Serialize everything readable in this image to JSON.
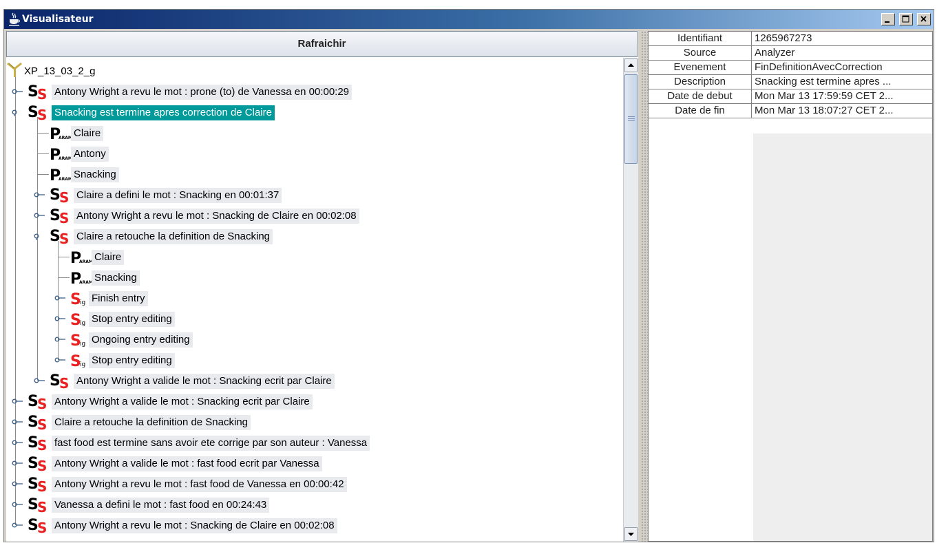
{
  "window": {
    "title": "Visualisateur",
    "controls": {
      "minimize": "minimize",
      "maximize": "maximize",
      "close": "close"
    }
  },
  "toolbar": {
    "refresh_label": "Rafraichir"
  },
  "tree": {
    "root": "XP_13_03_2_g",
    "rows": [
      {
        "label": "Antony Wright a revu le mot : prone (to) de Vanessa en 00:00:29"
      },
      {
        "label": "Snacking est termine apres correction de Claire",
        "selected": true
      },
      {
        "label": "Claire"
      },
      {
        "label": "Antony"
      },
      {
        "label": "Snacking"
      },
      {
        "label": "Claire a defini le mot : Snacking en 00:01:37"
      },
      {
        "label": "Antony Wright a revu le mot : Snacking de Claire en 00:02:08"
      },
      {
        "label": "Claire a retouche la definition de Snacking"
      },
      {
        "label": "Claire"
      },
      {
        "label": "Snacking"
      },
      {
        "label": "Finish entry"
      },
      {
        "label": "Stop entry editing"
      },
      {
        "label": "Ongoing entry editing"
      },
      {
        "label": "Stop entry editing"
      },
      {
        "label": "Antony Wright a valide le mot : Snacking ecrit par Claire"
      },
      {
        "label": "Antony Wright a valide le mot : Snacking ecrit par Claire"
      },
      {
        "label": "Claire a retouche la definition de Snacking"
      },
      {
        "label": "fast food est termine sans avoir ete corrige par son auteur : Vanessa"
      },
      {
        "label": "Antony Wright a valide le mot : fast food ecrit par Vanessa"
      },
      {
        "label": "Antony Wright a revu le mot : fast food de Vanessa en 00:00:42"
      },
      {
        "label": "Vanessa a defini le mot : fast food en 00:24:43"
      },
      {
        "label": "Antony Wright a revu le mot : Snacking de Claire en 00:02:08"
      }
    ]
  },
  "properties": {
    "rows": [
      {
        "key": "Identifiant",
        "value": "1265967273"
      },
      {
        "key": "Source",
        "value": "Analyzer"
      },
      {
        "key": "Evenement",
        "value": "FinDefinitionAvecCorrection"
      },
      {
        "key": "Description",
        "value": "Snacking est termine apres ..."
      },
      {
        "key": "Date de debut",
        "value": "Mon Mar 13 17:59:59 CET 2..."
      },
      {
        "key": "Date de fin",
        "value": "Mon Mar 13 18:07:27 CET 2..."
      }
    ]
  },
  "colors": {
    "selection": "#009a9a",
    "titlebar": "#0a246a",
    "event_red": "#e82020"
  }
}
